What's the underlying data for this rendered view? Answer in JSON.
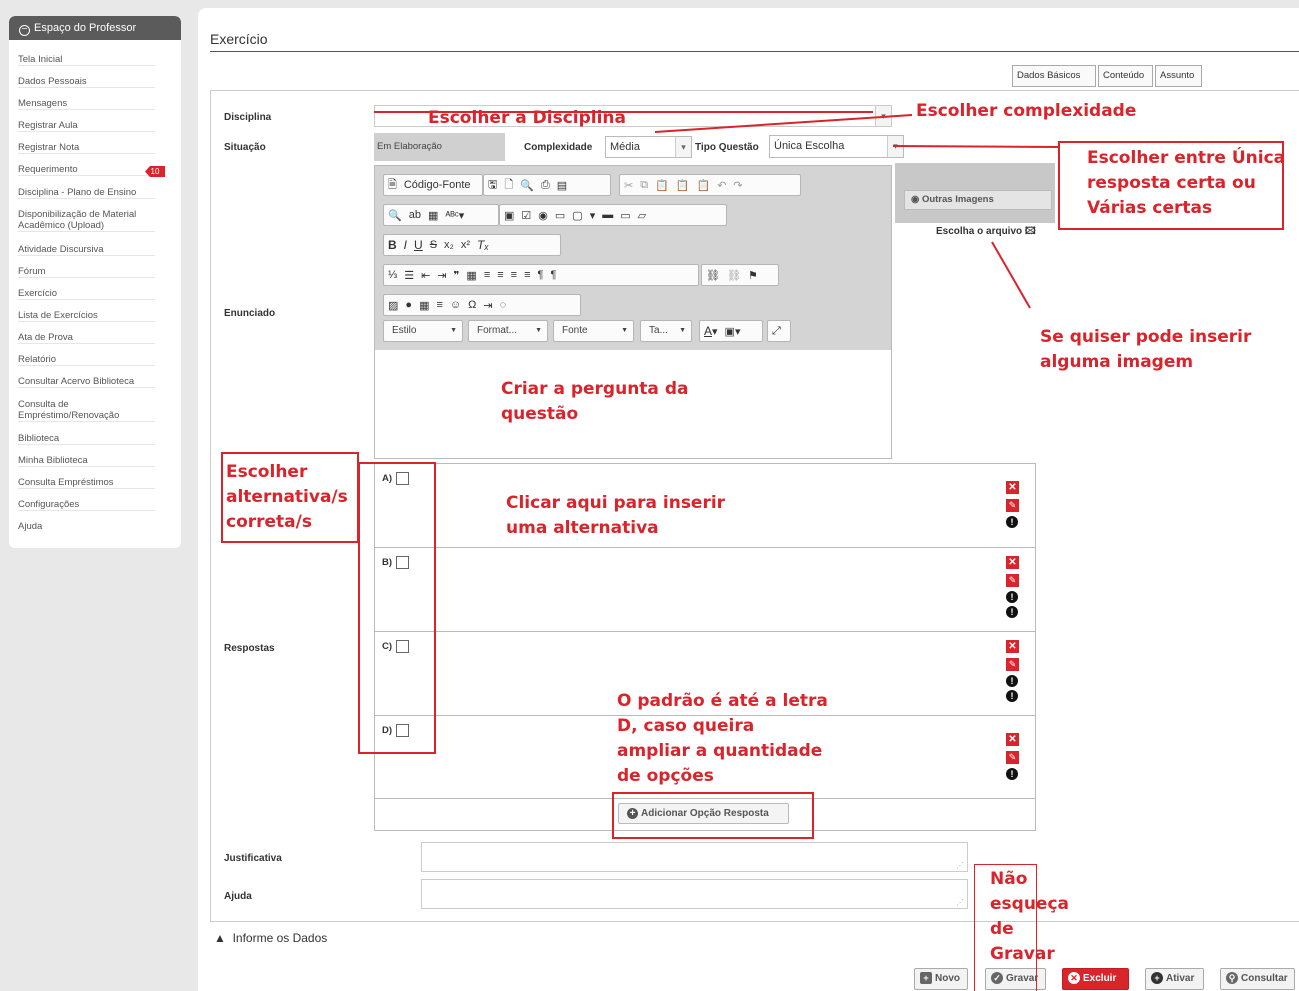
{
  "sidebar": {
    "header": "Espaço do Professor",
    "items": [
      "Tela Inicial",
      "Dados Pessoais",
      "Mensagens",
      "Registrar Aula",
      "Registrar Nota",
      "Requerimento",
      "Disciplina - Plano de Ensino",
      "Disponibilização de Material Acadêmico (Upload)",
      "Atividade Discursiva",
      "Fórum",
      "Exercício",
      "Lista de Exercícios",
      "Ata de Prova",
      "Relatório",
      "Consultar Acervo Biblioteca",
      "Consulta de Empréstimo/Renovação",
      "Biblioteca",
      "Minha Biblioteca",
      "Consulta Empréstimos",
      "Configurações",
      "Ajuda"
    ],
    "badge": "10"
  },
  "page": {
    "title": "Exercício"
  },
  "tabs": [
    "Dados Básicos",
    "Conteúdo",
    "Assunto"
  ],
  "form": {
    "disciplina_label": "Disciplina",
    "situacao_label": "Situação",
    "situacao_value": "Em Elaboração",
    "complexidade_label": "Complexidade",
    "complexidade_value": "Média",
    "tipo_label": "Tipo Questão",
    "tipo_value": "Única Escolha",
    "enunciado_label": "Enunciado",
    "respostas_label": "Respostas",
    "justificativa_label": "Justificativa",
    "ajuda_label": "Ajuda"
  },
  "editor": {
    "codigo_fonte": "Código-Fonte",
    "combo_estilo": "Estilo",
    "combo_format": "Format...",
    "combo_fonte": "Fonte",
    "combo_ta": "Ta..."
  },
  "image_panel": {
    "outras": "Outras Imagens",
    "escolha": "Escolha o arquivo"
  },
  "alternatives": [
    "A)",
    "B)",
    "C)",
    "D)"
  ],
  "add_option": "Adicionar Opção Resposta",
  "warning": "Informe os Dados",
  "buttons": {
    "novo": "Novo",
    "gravar": "Gravar",
    "excluir": "Excluir",
    "ativar": "Ativar",
    "consultar": "Consultar"
  },
  "annotations": {
    "disciplina": "Escolher a Disciplina",
    "complexidade": "Escolher complexidade",
    "tipo": [
      "Escolher entre Única",
      "resposta certa ou",
      "Várias certas"
    ],
    "imagem": [
      "Se quiser pode inserir",
      "alguma imagem"
    ],
    "pergunta": [
      "Criar a pergunta da",
      "questão"
    ],
    "correta": [
      "Escolher",
      "alternativa/s",
      "correta/s"
    ],
    "inserir": [
      "Clicar aqui para inserir",
      "uma alternativa"
    ],
    "padrao": [
      "O padrão é até a letra",
      "D, caso queira",
      "ampliar a quantidade",
      "de opções"
    ],
    "gravar": [
      "Não",
      "esqueça",
      "de",
      "Gravar"
    ]
  },
  "colors": {
    "accent": "#d9242b",
    "sidebar_header": "#5b5b5b"
  }
}
